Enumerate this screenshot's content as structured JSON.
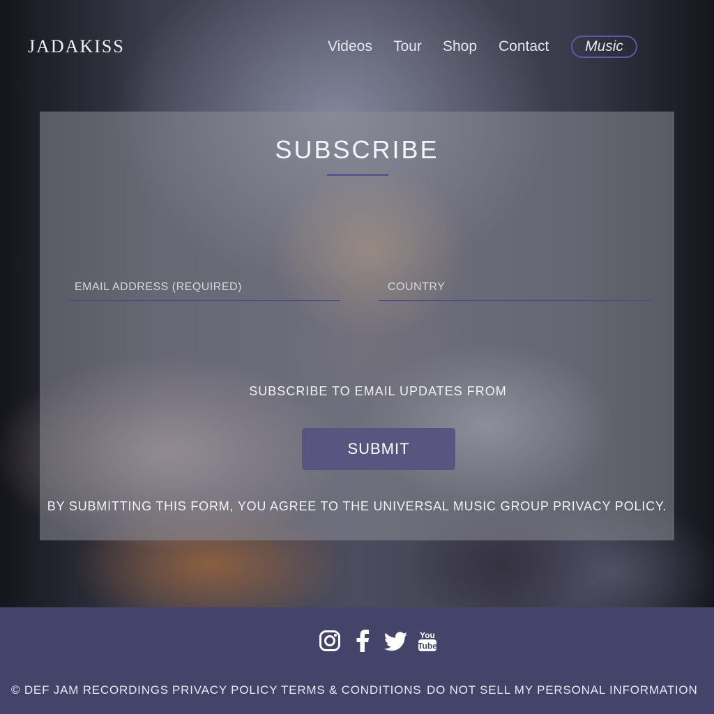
{
  "header": {
    "logo": "JADAKISS",
    "nav": [
      {
        "label": "Videos"
      },
      {
        "label": "Tour"
      },
      {
        "label": "Shop"
      },
      {
        "label": "Contact"
      },
      {
        "label": "Music"
      }
    ]
  },
  "subscribe": {
    "title": "SUBSCRIBE",
    "email_placeholder": "EMAIL ADDRESS (REQUIRED)",
    "email_value": "",
    "country_placeholder": "COUNTRY",
    "country_value": "",
    "updates_text": "SUBSCRIBE TO EMAIL UPDATES FROM",
    "submit_label": "SUBMIT",
    "policy_text": "BY SUBMITTING THIS FORM, YOU AGREE TO THE UNIVERSAL MUSIC GROUP PRIVACY POLICY."
  },
  "footer": {
    "social": [
      {
        "icon": "instagram-icon"
      },
      {
        "icon": "facebook-icon"
      },
      {
        "icon": "twitter-icon"
      },
      {
        "icon": "youtube-icon",
        "text": "You Tube"
      }
    ],
    "links": [
      {
        "label": "© DEF JAM RECORDINGS"
      },
      {
        "label": "PRIVACY POLICY"
      },
      {
        "label": "TERMS & CONDITIONS"
      },
      {
        "label": "DO NOT SELL MY PERSONAL INFORMATION"
      }
    ]
  },
  "colors": {
    "accent": "#585680",
    "footer_bg": "#44436a",
    "underline": "#4d4d86",
    "music_pill_border": "#5c5aa6"
  }
}
